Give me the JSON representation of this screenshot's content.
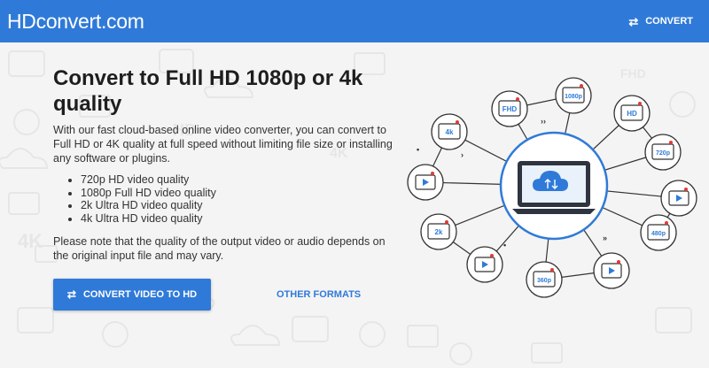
{
  "header": {
    "logo": "HDconvert.com",
    "nav_convert_icon": "⇄",
    "nav_convert_label": "CONVERT"
  },
  "main": {
    "title": "Convert to Full HD 1080p or 4k quality",
    "intro": "With our fast cloud-based online video converter, you can convert to Full HD or 4K quality at full speed without limiting file size or installing any software or plugins.",
    "features": [
      "720p HD video quality",
      "1080p Full HD video quality",
      "2k Ultra HD video quality",
      "4k Ultra HD video quality"
    ],
    "note": "Please note that the quality of the output video or audio depends on the original input file and may vary.",
    "primary_button": {
      "icon": "⇄",
      "label": "CONVERT VIDEO TO HD"
    },
    "secondary_link": "OTHER FORMATS"
  },
  "diagram": {
    "center_icon": "cloud-upload-download-icon",
    "nodes": [
      {
        "kind": "label",
        "text": "1080p"
      },
      {
        "kind": "label",
        "text": "HD"
      },
      {
        "kind": "label",
        "text": "720p"
      },
      {
        "kind": "icon",
        "icon": "presenter-video-icon"
      },
      {
        "kind": "label",
        "text": "480p"
      },
      {
        "kind": "icon",
        "icon": "video-player-icon"
      },
      {
        "kind": "label",
        "text": "360p"
      },
      {
        "kind": "icon",
        "icon": "phone-video-icon"
      },
      {
        "kind": "label",
        "text": "2k"
      },
      {
        "kind": "icon",
        "icon": "film-strip-icon"
      },
      {
        "kind": "label",
        "text": "4k"
      },
      {
        "kind": "label",
        "text": "FHD"
      }
    ]
  },
  "colors": {
    "brand": "#2f7ad8",
    "background": "#f4f4f4",
    "badge_accent": "#2f7ad8",
    "badge_red_dot": "#e53935"
  }
}
